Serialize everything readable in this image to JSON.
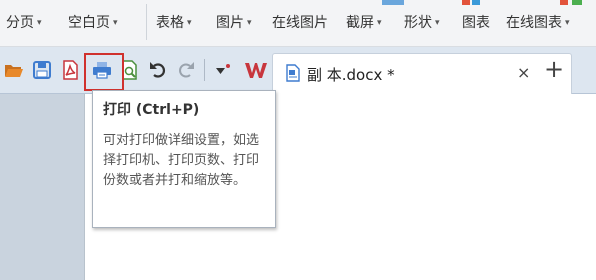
{
  "ribbon": {
    "items": [
      {
        "label": "分页",
        "name": "ribbon-item-page-break"
      },
      {
        "label": "空白页",
        "name": "ribbon-item-blank-page"
      },
      {
        "label": "表格",
        "name": "ribbon-item-table"
      },
      {
        "label": "图片",
        "name": "ribbon-item-picture"
      },
      {
        "label": "在线图片",
        "name": "ribbon-item-online-picture"
      },
      {
        "label": "截屏",
        "name": "ribbon-item-screenshot"
      },
      {
        "label": "形状",
        "name": "ribbon-item-shapes"
      },
      {
        "label": "图表",
        "name": "ribbon-item-chart"
      },
      {
        "label": "在线图表",
        "name": "ribbon-item-online-chart"
      }
    ],
    "arrow_glyph": "▾"
  },
  "quick_access": [
    {
      "name": "open-folder-icon"
    },
    {
      "name": "save-icon"
    },
    {
      "name": "export-pdf-icon"
    },
    {
      "name": "print-icon"
    },
    {
      "name": "print-preview-icon"
    },
    {
      "name": "undo-icon"
    },
    {
      "name": "redo-icon"
    },
    {
      "name": "customize-toolbar-icon"
    }
  ],
  "tab": {
    "title": "副 本.docx *",
    "close_glyph": "×"
  },
  "new_tab_glyph": "+",
  "tooltip": {
    "title": "打印 (Ctrl+P)",
    "body": "可对打印做详细设置，如选择打印机、打印页数、打印份数或者并打和缩放等。"
  },
  "colors": {
    "highlight": "#d0312d",
    "wps_brand": "#c8363d",
    "print_blue": "#3f7ccf",
    "folder_orange": "#e8892b"
  }
}
